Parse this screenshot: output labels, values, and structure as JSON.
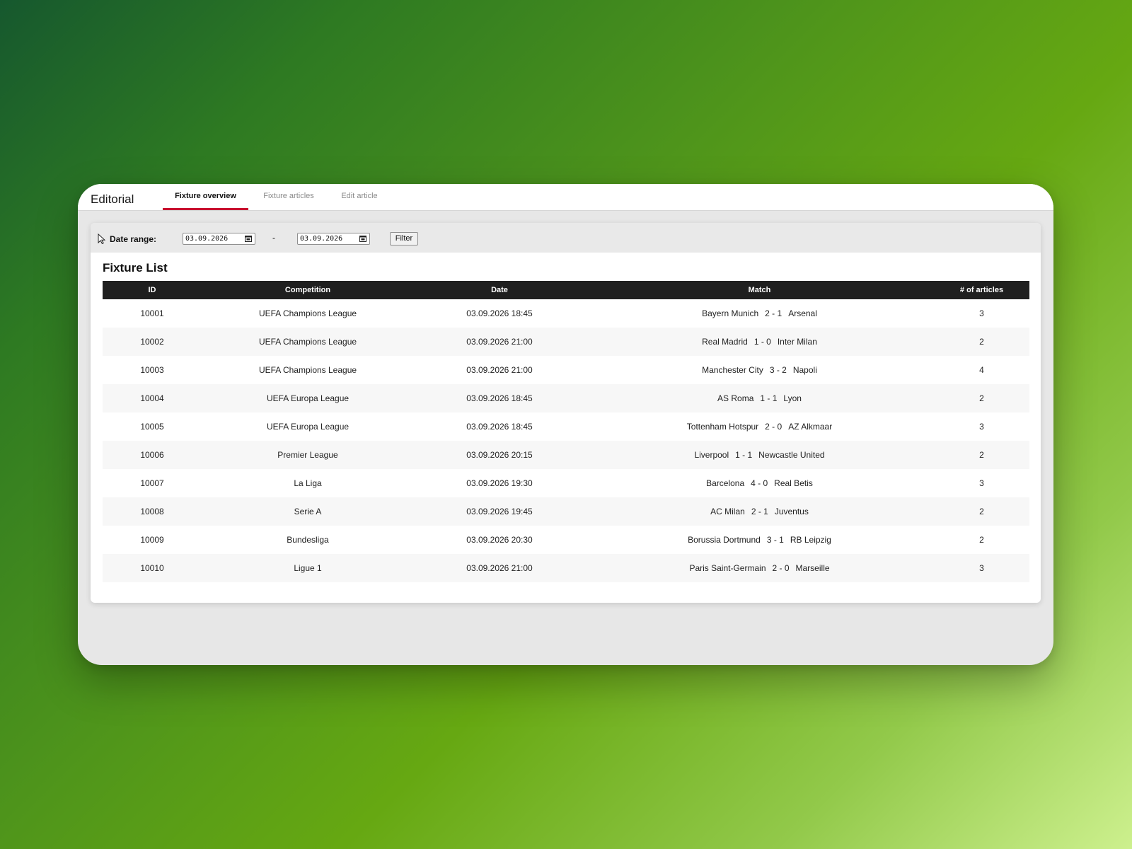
{
  "app": {
    "title": "Editorial"
  },
  "tabs": [
    {
      "label": "Fixture overview",
      "active": true
    },
    {
      "label": "Fixture articles",
      "active": false
    },
    {
      "label": "Edit article",
      "active": false
    }
  ],
  "filter": {
    "label": "Date range:",
    "from": "03.09.2026",
    "separator": "-",
    "to": "03.09.2026",
    "button_label": "Filter"
  },
  "fixture_list": {
    "title": "Fixture List",
    "columns": [
      "ID",
      "Competition",
      "Date",
      "Match",
      "# of articles"
    ],
    "rows": [
      {
        "id": "10001",
        "competition": "UEFA Champions League",
        "date": "03.09.2026 18:45",
        "home": "Bayern Munich",
        "score": "2 - 1",
        "away": "Arsenal",
        "articles": "3"
      },
      {
        "id": "10002",
        "competition": "UEFA Champions League",
        "date": "03.09.2026 21:00",
        "home": "Real Madrid",
        "score": "1 - 0",
        "away": "Inter Milan",
        "articles": "2"
      },
      {
        "id": "10003",
        "competition": "UEFA Champions League",
        "date": "03.09.2026 21:00",
        "home": "Manchester City",
        "score": "3 - 2",
        "away": "Napoli",
        "articles": "4"
      },
      {
        "id": "10004",
        "competition": "UEFA Europa League",
        "date": "03.09.2026 18:45",
        "home": "AS Roma",
        "score": "1 - 1",
        "away": "Lyon",
        "articles": "2"
      },
      {
        "id": "10005",
        "competition": "UEFA Europa League",
        "date": "03.09.2026 18:45",
        "home": "Tottenham Hotspur",
        "score": "2 - 0",
        "away": "AZ Alkmaar",
        "articles": "3"
      },
      {
        "id": "10006",
        "competition": "Premier League",
        "date": "03.09.2026 20:15",
        "home": "Liverpool",
        "score": "1 - 1",
        "away": "Newcastle United",
        "articles": "2"
      },
      {
        "id": "10007",
        "competition": "La Liga",
        "date": "03.09.2026 19:30",
        "home": "Barcelona",
        "score": "4 - 0",
        "away": "Real Betis",
        "articles": "3"
      },
      {
        "id": "10008",
        "competition": "Serie A",
        "date": "03.09.2026 19:45",
        "home": "AC Milan",
        "score": "2 - 1",
        "away": "Juventus",
        "articles": "2"
      },
      {
        "id": "10009",
        "competition": "Bundesliga",
        "date": "03.09.2026 20:30",
        "home": "Borussia Dortmund",
        "score": "3 - 1",
        "away": "RB Leipzig",
        "articles": "2"
      },
      {
        "id": "10010",
        "competition": "Ligue 1",
        "date": "03.09.2026 21:00",
        "home": "Paris Saint-Germain",
        "score": "2 - 0",
        "away": "Marseille",
        "articles": "3"
      }
    ]
  },
  "colors": {
    "accent": "#c8102e",
    "header_bg": "#1f1f1f",
    "window_bg": "#e7e7e7"
  },
  "icons": {
    "cursor": "mouse-pointer-icon",
    "calendar": "calendar-icon"
  }
}
